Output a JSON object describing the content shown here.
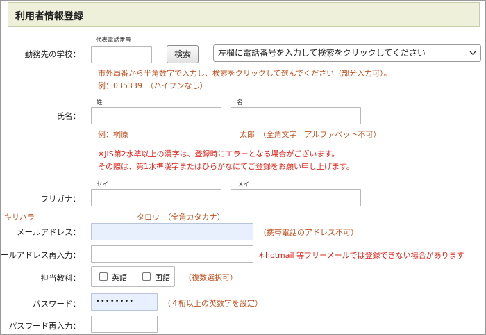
{
  "page_title": "利用者情報登録",
  "school": {
    "label": "勤務先の学校：",
    "phone_caption": "代表電話番号",
    "phone_value": "",
    "search_button": "検索",
    "select_value": "左欄に電話番号を入力して検索をクリックしてください",
    "note1": "市外局番から半角数字で入力し、検索をクリックして選んでください（部分入力可）。",
    "note2": "例：035339　（ハイフンなし）"
  },
  "name": {
    "label": "氏名：",
    "last_caption": "姓",
    "first_caption": "名",
    "last_value": "",
    "first_value": "",
    "example_last": "例：桐原",
    "example_first": "太郎　（全角文字　アルファベット不可）",
    "warning1": "※JIS第2水準以上の漢字は、登録時にエラーとなる場合がございます。",
    "warning2": "その際は、第1水準漢字またはひらがなにてご登録をお願い申し上げます。"
  },
  "furigana": {
    "label": "フリガナ：",
    "last_caption": "セイ",
    "first_caption": "メイ",
    "last_value": "",
    "first_value": "",
    "example_last": "キリハラ",
    "example_first": "タロウ　（全角カタカナ）"
  },
  "email": {
    "label": "メールアドレス：",
    "value": "",
    "note": "（携帯電話のアドレス不可）"
  },
  "email_confirm": {
    "label": "メールアドレス再入力：",
    "value": "",
    "note": "＊hotmail 等フリーメールでは登録できない場合があります"
  },
  "subject": {
    "label": "担当教科：",
    "options": [
      {
        "label": "英語",
        "checked": false
      },
      {
        "label": "国語",
        "checked": false
      }
    ],
    "note": "（複数選択可）"
  },
  "password": {
    "label": "パスワード：",
    "masked_value": "••••••••",
    "note": "（４桁以上の英数字を設定）"
  },
  "password_confirm": {
    "label": "パスワード再入力：",
    "value": ""
  },
  "colors": {
    "header_bg": "#eef0da",
    "note": "#c0501e",
    "warning": "#e0231a",
    "autofill": "#e8f0fe"
  }
}
